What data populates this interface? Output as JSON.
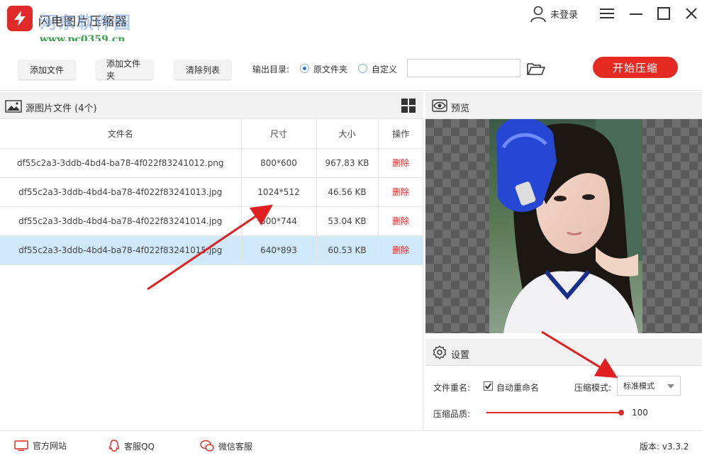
{
  "app": {
    "title": "闪电图片压缩器",
    "watermark": "河东软件园",
    "watermark_url": "www.pc0359.cn"
  },
  "titlebar": {
    "login_label": "未登录"
  },
  "toolbar": {
    "add_file": "添加文件",
    "add_folder": "添加文件夹",
    "clear_list": "清除列表",
    "output_dir_label": "输出目录:",
    "option_original": "原文件夹",
    "option_custom": "自定义",
    "path_value": "",
    "start_label": "开始压缩"
  },
  "files_panel": {
    "title": "源图片文件 (4个)",
    "columns": {
      "name": "文件名",
      "dimensions": "尺寸",
      "size": "大小",
      "action": "操作"
    },
    "rows": [
      {
        "name": "df55c2a3-3ddb-4bd4-ba78-4f022f83241012.png",
        "dimensions": "800*600",
        "size": "967.83 KB",
        "action": "删除",
        "selected": false
      },
      {
        "name": "df55c2a3-3ddb-4bd4-ba78-4f022f83241013.jpg",
        "dimensions": "1024*512",
        "size": "46.56 KB",
        "action": "删除",
        "selected": false
      },
      {
        "name": "df55c2a3-3ddb-4bd4-ba78-4f022f83241014.jpg",
        "dimensions": "600*744",
        "size": "53.04 KB",
        "action": "删除",
        "selected": false
      },
      {
        "name": "df55c2a3-3ddb-4bd4-ba78-4f022f83241015.jpg",
        "dimensions": "640*893",
        "size": "60.53 KB",
        "action": "删除",
        "selected": true
      }
    ]
  },
  "preview_panel": {
    "title": "预览"
  },
  "settings_panel": {
    "title": "设置",
    "rename_label": "文件重名:",
    "auto_rename_label": "自动重命名",
    "auto_rename_checked": true,
    "mode_label": "压缩模式:",
    "mode_value": "标准模式",
    "quality_label": "压缩品质:",
    "quality_value": "100"
  },
  "footer": {
    "website": "官方网站",
    "qq": "客服QQ",
    "wechat": "微信客服",
    "version": "版本: v3.3.2"
  },
  "colors": {
    "accent": "#e52a24",
    "selected_row": "#cfe8fa",
    "radio": "#2b7bd6"
  }
}
